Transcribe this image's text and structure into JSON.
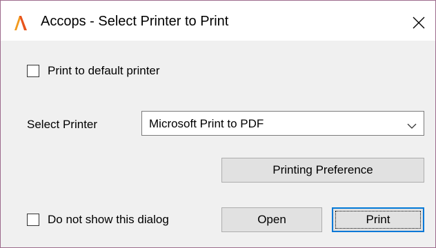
{
  "window": {
    "title": "Accops - Select Printer to Print",
    "accent_color": "#e8541c"
  },
  "options": {
    "print_default_label": "Print to default printer",
    "print_default_checked": false,
    "dont_show_label": "Do not show this dialog",
    "dont_show_checked": false
  },
  "printer": {
    "label": "Select Printer",
    "selected": "Microsoft Print to PDF"
  },
  "buttons": {
    "preference_label": "Printing Preference",
    "open_label": "Open",
    "print_label": "Print"
  },
  "icons": {
    "app": "accops-logo-icon",
    "close": "close-icon",
    "dropdown": "chevron-down-icon"
  }
}
